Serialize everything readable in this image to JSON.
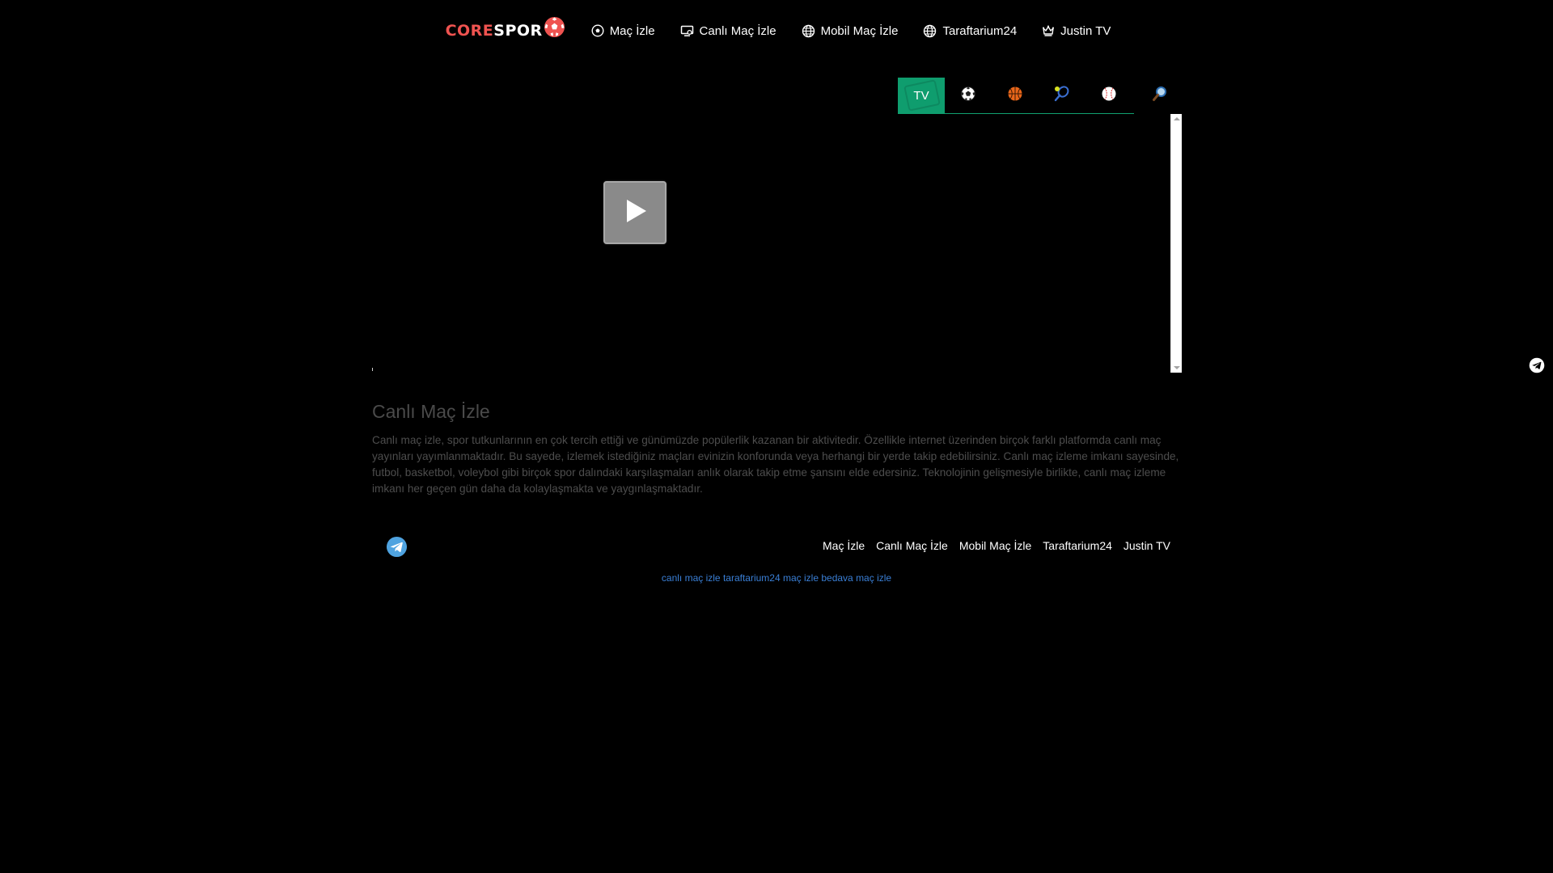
{
  "header": {
    "logo": {
      "part1": "CORE",
      "part2": "SPOR"
    },
    "nav": [
      {
        "label": "Maç İzle",
        "icon": "soccer-ball-icon"
      },
      {
        "label": "Canlı Maç İzle",
        "icon": "monitor-icon"
      },
      {
        "label": "Mobil Maç İzle",
        "icon": "globe-icon"
      },
      {
        "label": "Taraftarium24",
        "icon": "globe-icon"
      },
      {
        "label": "Justin TV",
        "icon": "crown-icon"
      }
    ]
  },
  "tabs": {
    "tv_label": "TV",
    "items": [
      {
        "icon": "soccer-ball-icon"
      },
      {
        "icon": "basketball-icon"
      },
      {
        "icon": "tennis-icon"
      },
      {
        "icon": "baseball-icon"
      },
      {
        "icon": "search-icon"
      }
    ],
    "active_color": "#0f9d6e"
  },
  "article": {
    "title": "Canlı Maç İzle",
    "body": "Canlı maç izle, spor tutkunlarının en çok tercih ettiği ve günümüzde popülerlik kazanan bir aktivitedir. Özellikle internet üzerinden birçok farklı platformda canlı maç yayınları yayımlanmaktadır. Bu sayede, izlemek istediğiniz maçları evinizin konforunda veya herhangi bir yerde takip edebilirsiniz. Canlı maç izleme imkanı sayesinde, futbol, basketbol, voleybol gibi birçok spor dalındaki karşılaşmaları anlık olarak takip etme şansını elde edersiniz. Teknolojinin gelişmesiyle birlikte, canlı maç izleme imkanı her geçen gün daha da kolaylaşmakta ve yaygınlaşmaktadır."
  },
  "footer": {
    "links": [
      "Maç İzle",
      "Canlı Maç İzle",
      "Mobil Maç İzle",
      "Taraftarium24",
      "Justin TV"
    ],
    "seo_links": [
      "canlı maç izle",
      "taraftarium24",
      "maç izle",
      "bedava maç izle"
    ]
  },
  "colors": {
    "background": "#000000",
    "accent_green": "#0f9d6e",
    "logo_red": "#ef5350",
    "telegram_blue": "#4fa3e0",
    "seo_link_blue": "#3a7fd6"
  }
}
